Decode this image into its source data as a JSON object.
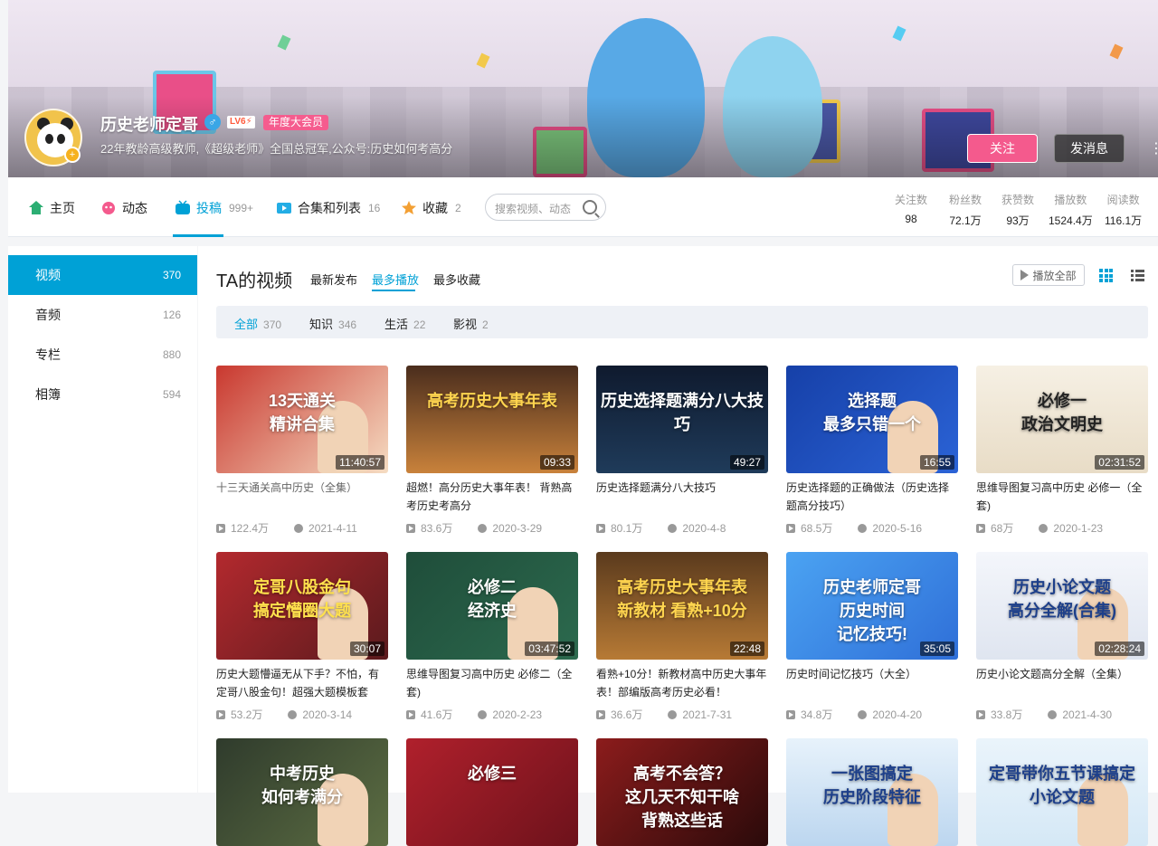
{
  "colors": {
    "accent": "#00a1d6",
    "pink": "#f45a8d",
    "vip": "#f55c8e"
  },
  "profile": {
    "name": "历史老师定哥",
    "gender_icon": "male-icon",
    "level": "LV6⚡",
    "vip_label": "年度大会员",
    "sign": "22年教龄高级教师,《超级老师》全国总冠军,公众号:历史如何考高分"
  },
  "actions": {
    "follow": "关注",
    "message": "发消息"
  },
  "nav": {
    "items": [
      {
        "label": "主页",
        "count": ""
      },
      {
        "label": "动态",
        "count": ""
      },
      {
        "label": "投稿",
        "count": "999+"
      },
      {
        "label": "合集和列表",
        "count": "16"
      },
      {
        "label": "收藏",
        "count": "2"
      }
    ],
    "search_placeholder": "搜索视频、动态"
  },
  "stats": [
    {
      "label": "关注数",
      "value": "98"
    },
    {
      "label": "粉丝数",
      "value": "72.1万"
    },
    {
      "label": "获赞数",
      "value": "93万"
    },
    {
      "label": "播放数",
      "value": "1524.4万"
    },
    {
      "label": "阅读数",
      "value": "116.1万"
    }
  ],
  "sidebar": {
    "items": [
      {
        "label": "视频",
        "count": "370"
      },
      {
        "label": "音频",
        "count": "126"
      },
      {
        "label": "专栏",
        "count": "880"
      },
      {
        "label": "相簿",
        "count": "594"
      }
    ]
  },
  "main": {
    "title": "TA的视频",
    "sort": [
      "最新发布",
      "最多播放",
      "最多收藏"
    ],
    "play_all": "播放全部",
    "filters": [
      {
        "label": "全部",
        "count": "370"
      },
      {
        "label": "知识",
        "count": "346"
      },
      {
        "label": "生活",
        "count": "22"
      },
      {
        "label": "影视",
        "count": "2"
      }
    ]
  },
  "videos": [
    {
      "thumb_text": "13天通关\n精讲合集",
      "duration": "11:40:57",
      "title": "十三天通关高中历史（全集）",
      "views": "122.4万",
      "date": "2021-4-11"
    },
    {
      "thumb_text": "高考历史大事年表",
      "duration": "09:33",
      "title": "超燃！高分历史大事年表！ 背熟高考历史考高分",
      "views": "83.6万",
      "date": "2020-3-29"
    },
    {
      "thumb_text": "历史选择题满分八大技巧",
      "duration": "49:27",
      "title": "历史选择题满分八大技巧",
      "views": "80.1万",
      "date": "2020-4-8"
    },
    {
      "thumb_text": "选择题\n最多只错一个",
      "duration": "16:55",
      "title": "历史选择题的正确做法（历史选择题高分技巧）",
      "views": "68.5万",
      "date": "2020-5-16"
    },
    {
      "thumb_text": "必修一\n政治文明史",
      "duration": "02:31:52",
      "title": "思维导图复习高中历史 必修一（全套)",
      "views": "68万",
      "date": "2020-1-23"
    },
    {
      "thumb_text": "定哥八股金句\n搞定懵圈大题",
      "duration": "30:07",
      "title": "历史大题懵逼无从下手？不怕，有定哥八股金句！超强大题模板套",
      "views": "53.2万",
      "date": "2020-3-14"
    },
    {
      "thumb_text": "必修二\n经济史",
      "duration": "03:47:52",
      "title": "思维导图复习高中历史 必修二（全套)",
      "views": "41.6万",
      "date": "2020-2-23"
    },
    {
      "thumb_text": "高考历史大事年表\n新教材 看熟+10分",
      "duration": "22:48",
      "title": "看熟+10分！新教材高中历史大事年表！部编版高考历史必看！",
      "views": "36.6万",
      "date": "2021-7-31"
    },
    {
      "thumb_text": "历史老师定哥\n历史时间\n记忆技巧!",
      "duration": "35:05",
      "title": "历史时间记忆技巧（大全）",
      "views": "34.8万",
      "date": "2020-4-20"
    },
    {
      "thumb_text": "历史小论文题\n高分全解(合集)",
      "duration": "02:28:24",
      "title": "历史小论文题高分全解（全集）",
      "views": "33.8万",
      "date": "2021-4-30"
    },
    {
      "thumb_text": "中考历史\n如何考满分",
      "duration": "",
      "title": "",
      "views": "",
      "date": ""
    },
    {
      "thumb_text": "必修三",
      "duration": "",
      "title": "",
      "views": "",
      "date": ""
    },
    {
      "thumb_text": "高考不会答？\n这几天不知干啥\n背熟这些话",
      "duration": "",
      "title": "",
      "views": "",
      "date": ""
    },
    {
      "thumb_text": "一张图搞定\n历史阶段特征",
      "duration": "",
      "title": "",
      "views": "",
      "date": ""
    },
    {
      "thumb_text": "定哥带你五节课搞定\n小论文题",
      "duration": "",
      "title": "",
      "views": "",
      "date": ""
    }
  ]
}
